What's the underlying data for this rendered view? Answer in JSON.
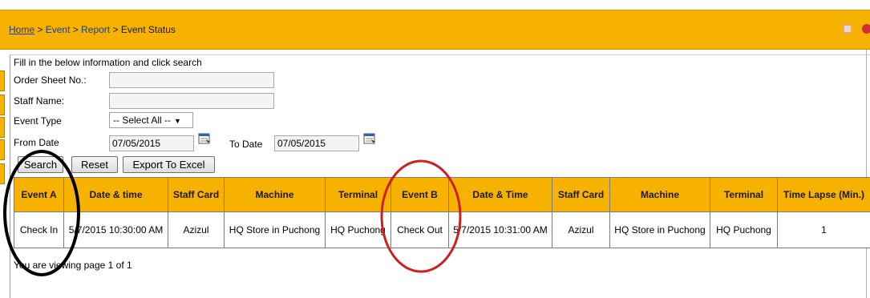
{
  "breadcrumb": {
    "home": "Home",
    "sep": ">",
    "event": "Event",
    "report": "Report",
    "current": "Event Status"
  },
  "form": {
    "instruction": "Fill in the below information and click search",
    "order_sheet_label": "Order Sheet No.:",
    "order_sheet_value": "",
    "staff_name_label": "Staff Name:",
    "staff_name_value": "",
    "event_type_label": "Event Type",
    "event_type_selected": "-- Select All --",
    "from_date_label": "From Date",
    "from_date_value": "07/05/2015",
    "to_date_label": "To Date",
    "to_date_value": "07/05/2015"
  },
  "buttons": {
    "search": "Search",
    "reset": "Reset",
    "export": "Export To Excel"
  },
  "table": {
    "headers": [
      "Event A",
      "Date & time",
      "Staff Card",
      "Machine",
      "Terminal",
      "Event B",
      "Date & Time",
      "Staff Card",
      "Machine",
      "Terminal",
      "Time Lapse (Min.)"
    ],
    "rows": [
      [
        "Check In",
        "5/7/2015 10:30:00 AM",
        "Azizul",
        "HQ Store in Puchong",
        "HQ Puchong",
        "Check Out",
        "5/7/2015 10:31:00 AM",
        "Azizul",
        "HQ Store in Puchong",
        "HQ Puchong",
        "1"
      ]
    ]
  },
  "pager": {
    "text": "You are viewing page 1   of  1"
  },
  "colors": {
    "accent": "#f7b200",
    "annotation_black": "#000000",
    "annotation_red": "#cc2020"
  },
  "icons": [
    "calendar-icon",
    "calendar-icon",
    "dropdown-arrow-icon"
  ]
}
